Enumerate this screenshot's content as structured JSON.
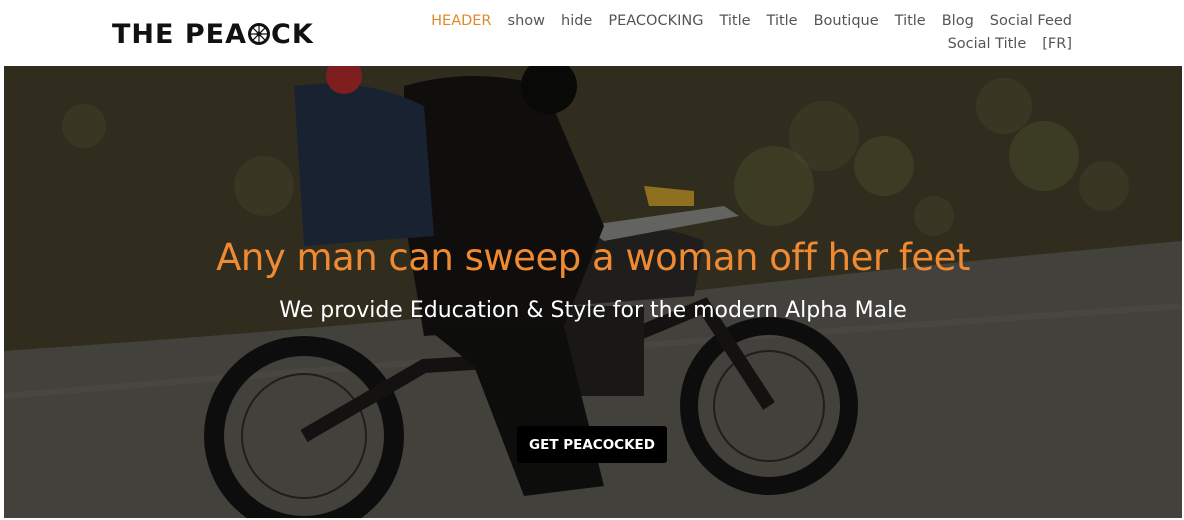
{
  "header": {
    "logo_text_left": "THE PEA",
    "logo_text_right": "CK",
    "nav": [
      {
        "label": "HEADER",
        "active": true
      },
      {
        "label": "show"
      },
      {
        "label": "hide"
      },
      {
        "label": "PEACOCKING"
      },
      {
        "label": "Title"
      },
      {
        "label": "Title"
      },
      {
        "label": "Boutique"
      },
      {
        "label": "Title"
      },
      {
        "label": "Blog"
      },
      {
        "label": "Social Feed"
      },
      {
        "label": "Social Title"
      },
      {
        "label": "[FR]"
      }
    ]
  },
  "hero": {
    "headline": "Any man can sweep a woman off her feet",
    "subheadline": "We provide Education & Style for the modern Alpha Male",
    "cta_label": "GET PEACOCKED"
  },
  "colors": {
    "accent": "#ef8a33",
    "nav_active": "#e08a2c",
    "cta_bg": "#000000"
  }
}
